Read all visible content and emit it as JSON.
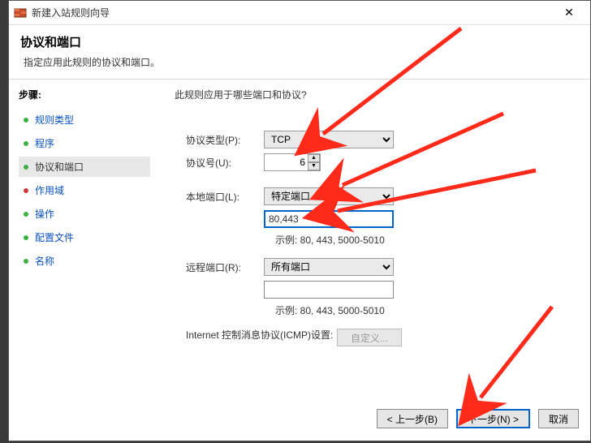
{
  "window": {
    "title": "新建入站规则向导",
    "close": "✕"
  },
  "header": {
    "title": "协议和端口",
    "subtitle": "指定应用此规则的协议和端口。"
  },
  "sidebar": {
    "steps_label": "步骤:",
    "items": [
      {
        "label": "规则类型",
        "done": true
      },
      {
        "label": "程序",
        "done": true
      },
      {
        "label": "协议和端口",
        "current": true
      },
      {
        "label": "作用域",
        "done": false
      },
      {
        "label": "操作",
        "done": false
      },
      {
        "label": "配置文件",
        "done": false
      },
      {
        "label": "名称",
        "done": false
      }
    ]
  },
  "form": {
    "prompt": "此规则应用于哪些端口和协议?",
    "protocol_type_label": "协议类型(P):",
    "protocol_type_value": "TCP",
    "protocol_num_label": "协议号(U):",
    "protocol_num_value": "6",
    "local_port_label": "本地端口(L):",
    "local_port_mode": "特定端口",
    "local_port_value": "80,443",
    "local_port_example": "示例: 80, 443, 5000-5010",
    "remote_port_label": "远程端口(R):",
    "remote_port_mode": "所有端口",
    "remote_port_value": "",
    "remote_port_example": "示例: 80, 443, 5000-5010",
    "icmp_label": "Internet 控制消息协议(ICMP)设置:",
    "icmp_btn": "自定义..."
  },
  "footer": {
    "back": "< 上一步(B)",
    "next": "下一步(N) >",
    "cancel": "取消"
  },
  "colors": {
    "accent": "#0064c8",
    "arrow": "#ff2a1a"
  }
}
